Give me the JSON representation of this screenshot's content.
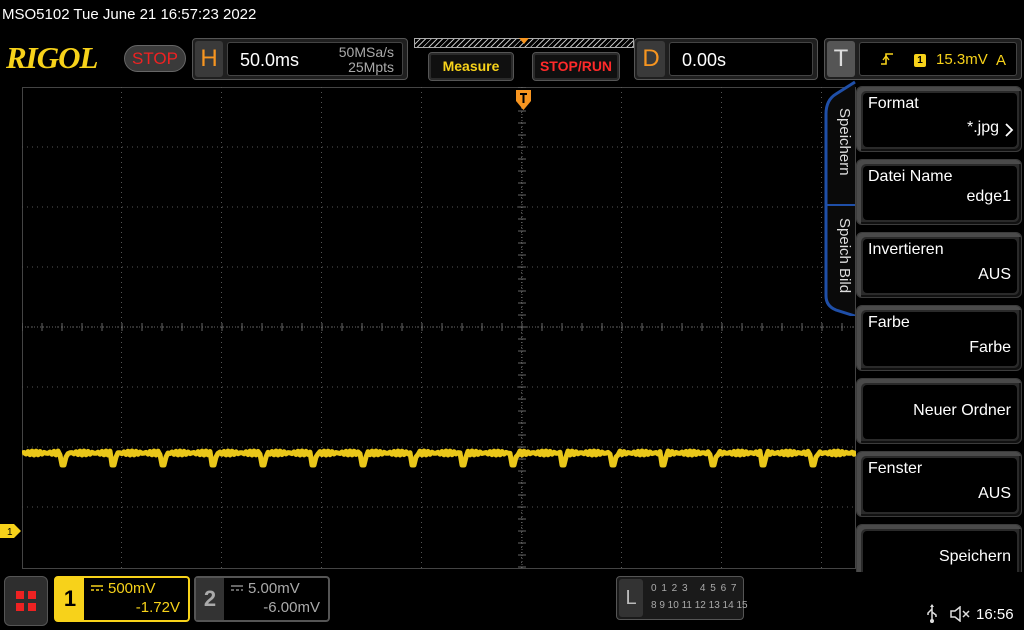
{
  "title_bar": {
    "text": "MSO5102  Tue June 21 16:57:23 2022"
  },
  "toolbar": {
    "logo": "RIGOL",
    "run_state": "STOP",
    "horizontal": {
      "letter": "H",
      "timebase": "50.0ms",
      "sample_rate": "50MSa/s",
      "memory_depth": "25Mpts"
    },
    "measure_label": "Measure",
    "stop_run_label": "STOP/RUN",
    "delay": {
      "letter": "D",
      "value": "0.00s"
    },
    "trigger": {
      "letter": "T",
      "channel": "1",
      "level": "15.3mV",
      "mode": "A",
      "edge_icon": "rising-edge-icon"
    }
  },
  "side_menu": {
    "tabs": [
      "Speichern",
      "Speich Bild"
    ],
    "items": [
      {
        "title": "Format",
        "value": "*.jpg"
      },
      {
        "title": "Datei Name",
        "value": "edge1"
      },
      {
        "title": "Invertieren",
        "value": "AUS"
      },
      {
        "title": "Farbe",
        "value": "Farbe"
      },
      {
        "title": "",
        "value": "Neuer Ordner"
      },
      {
        "title": "Fenster",
        "value": "AUS"
      },
      {
        "title": "",
        "value": "Speichern"
      }
    ]
  },
  "channels": {
    "ch1": {
      "number": "1",
      "scale": "500mV",
      "offset": "-1.72V",
      "ground_marker": "1"
    },
    "ch2": {
      "number": "2",
      "scale": "5.00mV",
      "offset": "-6.00mV"
    }
  },
  "logic_analyzer": {
    "letter": "L",
    "row1": "0 1 2 3   4 5 6 7",
    "row2": "8 9 10 11 12 13 14 15"
  },
  "status": {
    "time": "16:56",
    "usb_icon": "usb-icon",
    "speaker_icon": "speaker-muted-icon"
  },
  "colors": {
    "ch1": "#f7d21a",
    "accent": "#f79520",
    "stop": "#e22222",
    "menu_accent": "#1f4fa8"
  }
}
